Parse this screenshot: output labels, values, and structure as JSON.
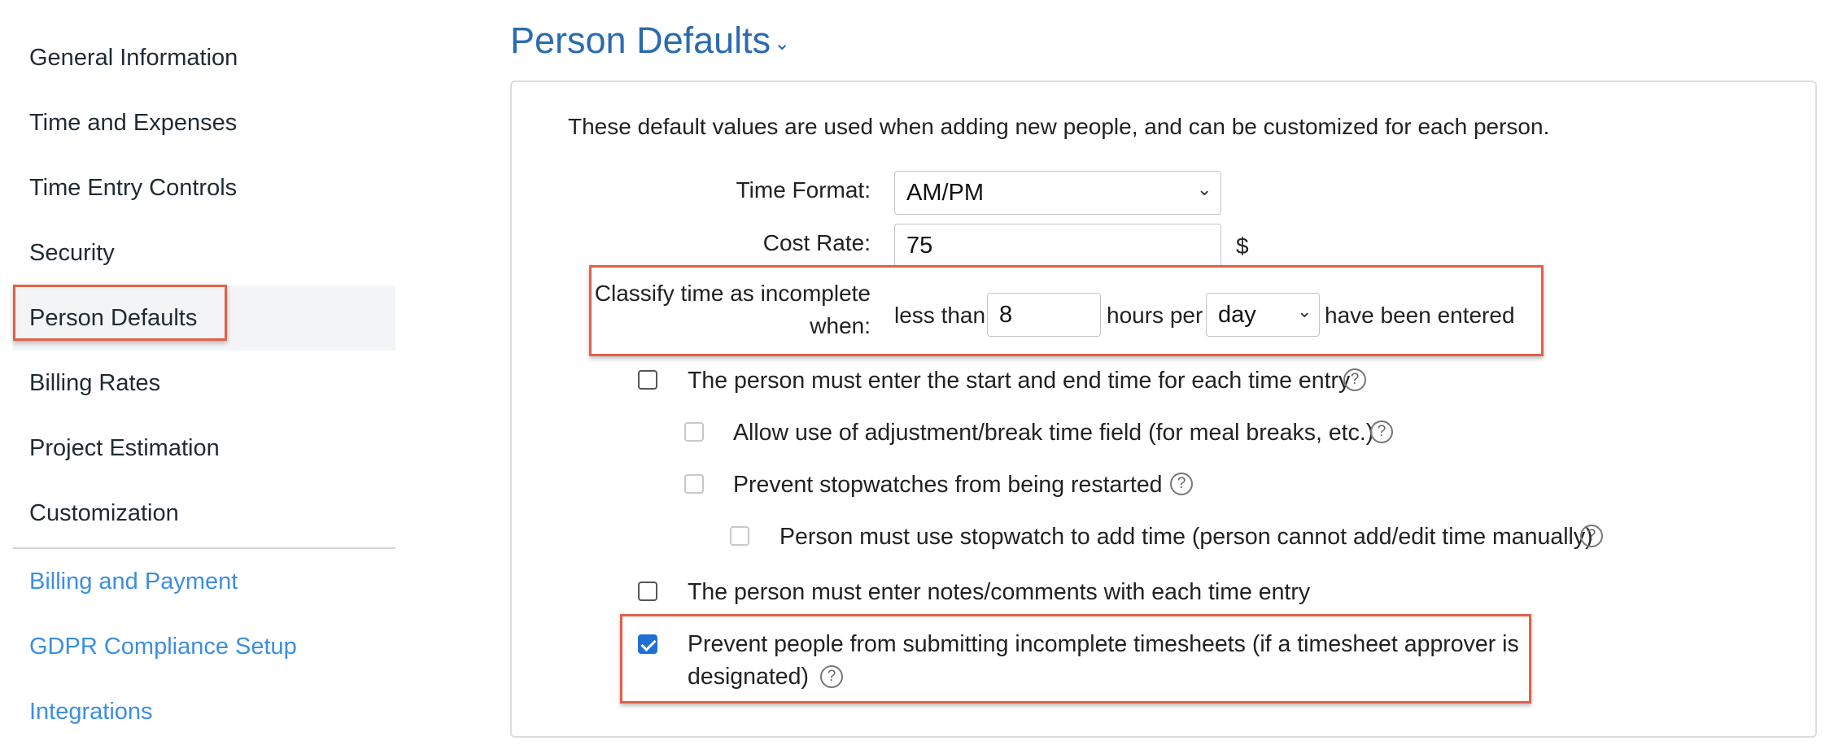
{
  "sidebar": {
    "items": [
      {
        "label": "General Information"
      },
      {
        "label": "Time and Expenses"
      },
      {
        "label": "Time Entry Controls"
      },
      {
        "label": "Security"
      },
      {
        "label": "Person Defaults"
      },
      {
        "label": "Billing Rates"
      },
      {
        "label": "Project Estimation"
      },
      {
        "label": "Customization"
      }
    ],
    "links": [
      {
        "label": "Billing and Payment"
      },
      {
        "label": "GDPR Compliance Setup"
      },
      {
        "label": "Integrations"
      }
    ]
  },
  "main": {
    "title": "Person Defaults",
    "caret": "⌄",
    "intro": "These default values are used when adding new people, and can be customized for each person.",
    "time_format": {
      "label": "Time Format:",
      "value": "AM/PM"
    },
    "cost_rate": {
      "label": "Cost Rate:",
      "value": "75",
      "unit": "$"
    },
    "incomplete": {
      "label_line1": "Classify time as incomplete",
      "label_line2": "when:",
      "less_than": "less than",
      "hours_value": "8",
      "hours_per": "hours per",
      "period": "day",
      "suffix": "have been entered"
    },
    "options": {
      "start_end": "The person must enter the start and end time for each time entry",
      "adjustment": "Allow use of adjustment/break time field (for meal breaks, etc.)",
      "stopwatch_restart": "Prevent stopwatches from being restarted",
      "stopwatch_only": "Person must use stopwatch to add time (person cannot add/edit time manually)",
      "notes": "The person must enter notes/comments with each time entry",
      "prevent_incomplete_line1": "Prevent people from submitting incomplete timesheets (if a timesheet approver is",
      "prevent_incomplete_line2": "designated)"
    },
    "help_glyph": "?",
    "chevron": "⌄"
  },
  "colors": {
    "accent": "#2a6bb0",
    "link": "#3d8ee0",
    "highlight": "#e0604a",
    "checkbox": "#1f6fd6"
  }
}
